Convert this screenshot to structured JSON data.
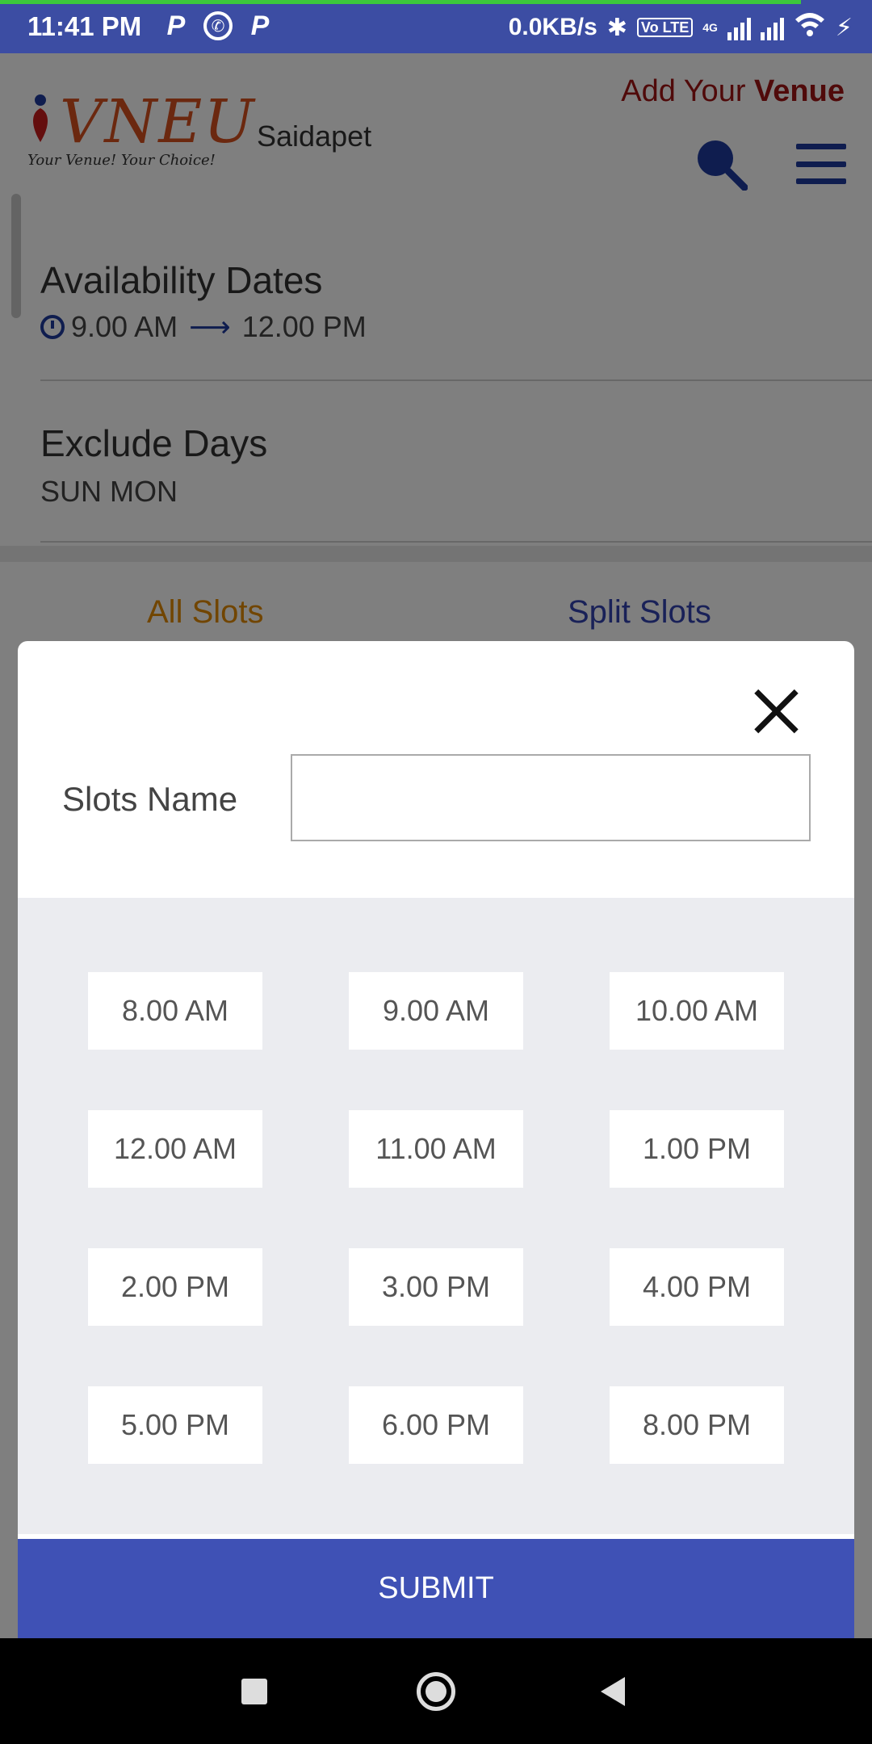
{
  "status_bar": {
    "time": "11:41 PM",
    "speed": "0.0KB/s",
    "volte": "Vo LTE",
    "network": "4G"
  },
  "header": {
    "logo_text": "VNEU",
    "logo_tagline": "Your Venue! Your Choice!",
    "location": "Saidapet",
    "add_venue_prefix": "Add Your ",
    "add_venue_bold": "Venue"
  },
  "availability": {
    "title": "Availability Dates",
    "start_time": "9.00 AM",
    "end_time": "12.00 PM"
  },
  "exclude": {
    "title": "Exclude Days",
    "days": "SUN MON"
  },
  "tabs": {
    "all": "All Slots",
    "split": "Split Slots"
  },
  "modal": {
    "slots_label": "Slots Name",
    "slots_value": "",
    "submit_label": "SUBMIT",
    "time_slots": [
      "8.00 AM",
      "9.00 AM",
      "10.00 AM",
      "12.00 AM",
      "11.00 AM",
      "1.00 PM",
      "2.00 PM",
      "3.00 PM",
      "4.00 PM",
      "5.00 PM",
      "6.00 PM",
      "8.00 PM"
    ]
  },
  "colors": {
    "status_bar": "#3c4da3",
    "submit": "#3f51b5",
    "brand_red": "#a01515",
    "tab_active": "#e28a00",
    "tab_inactive": "#3342b0"
  },
  "icons": [
    "p-icon",
    "whatsapp-icon",
    "bluetooth-icon",
    "signal-icon",
    "wifi-icon",
    "charging-icon",
    "search-icon",
    "menu-icon",
    "clock-icon",
    "arrow-right-icon",
    "close-icon",
    "recents-icon",
    "home-icon",
    "back-icon"
  ]
}
